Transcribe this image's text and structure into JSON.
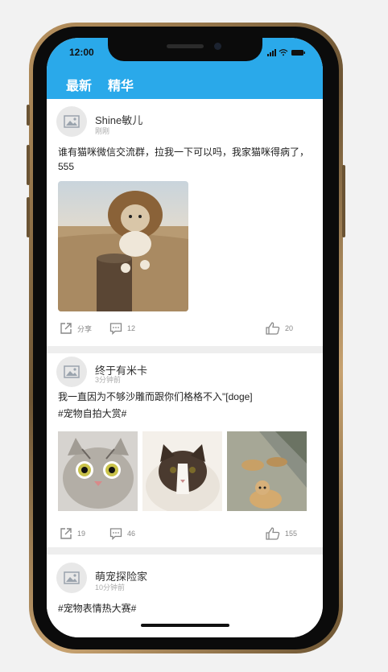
{
  "status_bar": {
    "time": "12:00"
  },
  "nav": {
    "tabs": [
      {
        "label": "最新"
      },
      {
        "label": "精华"
      }
    ]
  },
  "posts": [
    {
      "author": "Shine敏儿",
      "time": "刚刚",
      "text": "谁有猫咪微信交流群，拉我一下可以吗，我家猫咪得病了，555",
      "share_label": "分享",
      "comments": "12",
      "likes": "20"
    },
    {
      "author": "终于有米卡",
      "time": "3分钟前",
      "text": "我一直因为不够沙雕而跟你们格格不入\"[doge]",
      "tag": "#宠物自拍大赏#",
      "shares": "19",
      "comments": "46",
      "likes": "155"
    },
    {
      "author": "萌宠探险家",
      "time": "10分钟前",
      "text": "#宠物表情热大赛#"
    }
  ]
}
